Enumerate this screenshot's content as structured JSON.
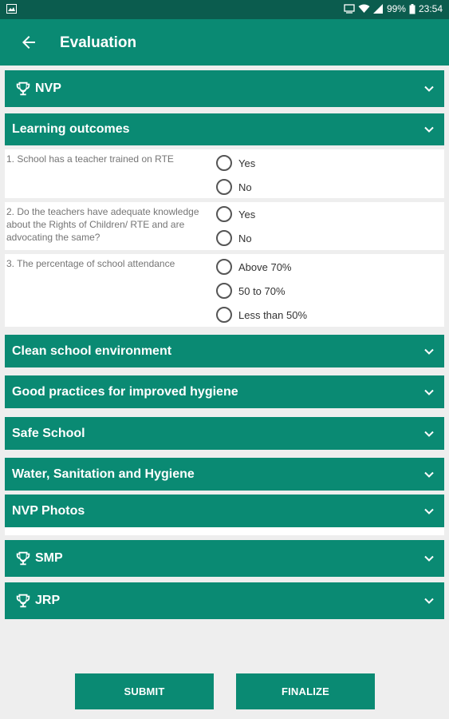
{
  "status_bar": {
    "battery": "99%",
    "time": "23:54",
    "icons": [
      "image-icon",
      "cast-icon",
      "wifi-icon",
      "signal-icon",
      "battery-icon"
    ]
  },
  "app_bar": {
    "title": "Evaluation",
    "back_icon": "arrow-left-icon"
  },
  "colors": {
    "primary": "#0a8a73",
    "primary_dark": "#0b5c4e",
    "background": "#eeeeee"
  },
  "programs": {
    "nvp": {
      "label": "NVP"
    },
    "smp": {
      "label": "SMP"
    },
    "jrp": {
      "label": "JRP"
    }
  },
  "sections": {
    "learning_outcomes": "Learning outcomes",
    "clean_school": "Clean school environment",
    "good_practices": "Good practices for improved hygiene",
    "safe_school": "Safe School",
    "wash": "Water, Sanitation and Hygiene",
    "nvp_photos": "NVP Photos"
  },
  "questions": [
    {
      "text": "1. School has a teacher trained on RTE",
      "options": [
        "Yes",
        "No"
      ]
    },
    {
      "text": "2. Do the teachers have adequate knowledge about the Rights of Children/ RTE and are advocating the same?",
      "options": [
        "Yes",
        "No"
      ]
    },
    {
      "text": "3. The percentage of school attendance",
      "options": [
        "Above 70%",
        "50 to 70%",
        "Less than 50%"
      ]
    }
  ],
  "buttons": {
    "submit": "SUBMIT",
    "finalize": "FINALIZE"
  }
}
